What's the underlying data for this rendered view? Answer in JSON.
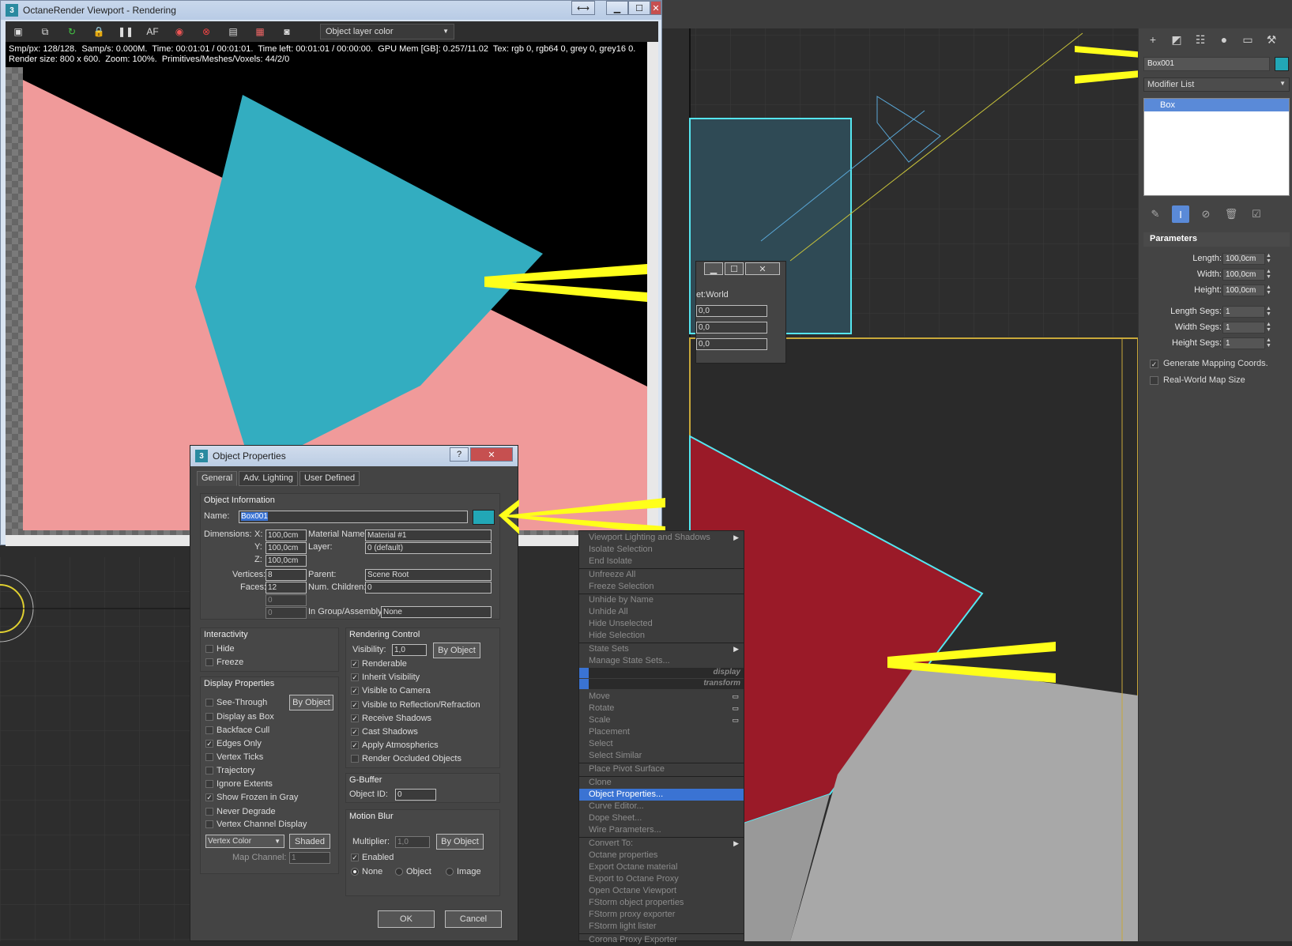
{
  "colors": {
    "object_cyan": "#22a7b6",
    "render_pink": "#f09a9a",
    "render_teal": "#33adc0",
    "viewport_red": "#9a1a28",
    "highlight_blue": "#3a73d3",
    "annotation_yellow": "#ffff1a"
  },
  "octane": {
    "title": "OctaneRender Viewport - Rendering",
    "select_value": "Object layer color",
    "info_line1": "Smp/px: 128/128.  Samp/s: 0.000M.  Time: 00:01:01 / 00:01:01.  Time left: 00:01:01 / 00:00:00.  GPU Mem [GB]: 0.257/11.02  Tex: rgb 0, rgb64 0, grey 0, grey16 0.",
    "info_line2": "Render size: 800 x 600.  Zoom: 100%.  Primitives/Meshes/Voxels: 44/2/0",
    "toolbar_icons": [
      "save-icon",
      "copy-icon",
      "refresh-icon",
      "lock-icon",
      "pause-icon",
      "af-icon",
      "color-wheel-icon",
      "no-entry-icon",
      "monitor-icon",
      "film-icon",
      "camera-icon"
    ],
    "win_buttons": {
      "resize": "⟷",
      "minimize": "▁",
      "maximize": "☐",
      "close": "✕"
    }
  },
  "command_panel": {
    "tab_icons": [
      "create-icon",
      "modify-icon",
      "hierarchy-icon",
      "motion-icon",
      "display-icon",
      "utilities-icon"
    ],
    "object_name": "Box001",
    "modifier_list_label": "Modifier List",
    "stack_item": "Box",
    "parameters_title": "Parameters",
    "params": [
      {
        "label": "Length:",
        "value": "100,0cm"
      },
      {
        "label": "Width:",
        "value": "100,0cm"
      },
      {
        "label": "Height:",
        "value": "100,0cm"
      },
      {
        "label": "Length Segs:",
        "value": "1"
      },
      {
        "label": "Width Segs:",
        "value": "1"
      },
      {
        "label": "Height Segs:",
        "value": "1"
      }
    ],
    "generate_mapping": "Generate Mapping Coords.",
    "real_world_map": "Real-World Map Size"
  },
  "xform_dialog": {
    "label": "et:World",
    "values": [
      "0,0",
      "0,0",
      "0,0"
    ]
  },
  "object_properties": {
    "title": "Object Properties",
    "help": "?",
    "close": "✕",
    "tabs": [
      "General",
      "Adv. Lighting",
      "User Defined"
    ],
    "object_information": "Object Information",
    "name_label": "Name:",
    "name_value": "Box001",
    "dimensions_label": "Dimensions:",
    "x_label": "X:",
    "x_value": "100,0cm",
    "y_label": "Y:",
    "y_value": "100,0cm",
    "z_label": "Z:",
    "z_value": "100,0cm",
    "material_name_label": "Material Name:",
    "material_name_value": "Material #1",
    "layer_label": "Layer:",
    "layer_value": "0 (default)",
    "vertices_label": "Vertices:",
    "vertices_value": "8",
    "faces_label": "Faces:",
    "faces_value": "12",
    "parent_label": "Parent:",
    "parent_value": "Scene Root",
    "num_children_label": "Num. Children:",
    "num_children_value": "0",
    "extra1": "0",
    "extra2": "0",
    "in_group_label": "In Group/Assembly:",
    "in_group_value": "None",
    "interactivity": "Interactivity",
    "hide": "Hide",
    "freeze": "Freeze",
    "display_properties": "Display Properties",
    "see_through": "See-Through",
    "by_object": "By Object",
    "display_as_box": "Display as Box",
    "backface_cull": "Backface Cull",
    "edges_only": "Edges Only",
    "vertex_ticks": "Vertex Ticks",
    "trajectory": "Trajectory",
    "ignore_extents": "Ignore Extents",
    "show_frozen_gray": "Show Frozen in Gray",
    "never_degrade": "Never Degrade",
    "vertex_channel_display": "Vertex Channel Display",
    "vertex_color": "Vertex Color",
    "shaded": "Shaded",
    "map_channel_label": "Map Channel:",
    "map_channel_value": "1",
    "rendering_control": "Rendering Control",
    "visibility_label": "Visibility:",
    "visibility_value": "1,0",
    "renderable": "Renderable",
    "inherit_visibility": "Inherit Visibility",
    "visible_to_camera": "Visible to Camera",
    "visible_to_reflection": "Visible to Reflection/Refraction",
    "receive_shadows": "Receive Shadows",
    "cast_shadows": "Cast Shadows",
    "apply_atmospherics": "Apply Atmospherics",
    "render_occluded": "Render Occluded Objects",
    "gbuffer": "G-Buffer",
    "object_id_label": "Object ID:",
    "object_id_value": "0",
    "motion_blur": "Motion Blur",
    "multiplier_label": "Multiplier:",
    "multiplier_value": "1,0",
    "enabled": "Enabled",
    "none": "None",
    "object": "Object",
    "image": "Image",
    "ok": "OK",
    "cancel": "Cancel"
  },
  "context_menu": {
    "items": [
      "Viewport Lighting and Shadows",
      "Isolate Selection",
      "End Isolate",
      "Unfreeze All",
      "Freeze Selection",
      "Unhide by Name",
      "Unhide All",
      "Hide Unselected",
      "Hide Selection",
      "State Sets",
      "Manage State Sets...",
      "display",
      "transform",
      "Move",
      "Rotate",
      "Scale",
      "Placement",
      "Select",
      "Select Similar",
      "Place Pivot Surface",
      "Clone",
      "Object Properties...",
      "Curve Editor...",
      "Dope Sheet...",
      "Wire Parameters...",
      "Convert To:",
      "Octane properties",
      "Export Octane material",
      "Export to Octane Proxy",
      "Open Octane Viewport",
      "FStorm object properties",
      "FStorm proxy exporter",
      "FStorm light lister",
      "Corona Proxy Exporter"
    ]
  }
}
